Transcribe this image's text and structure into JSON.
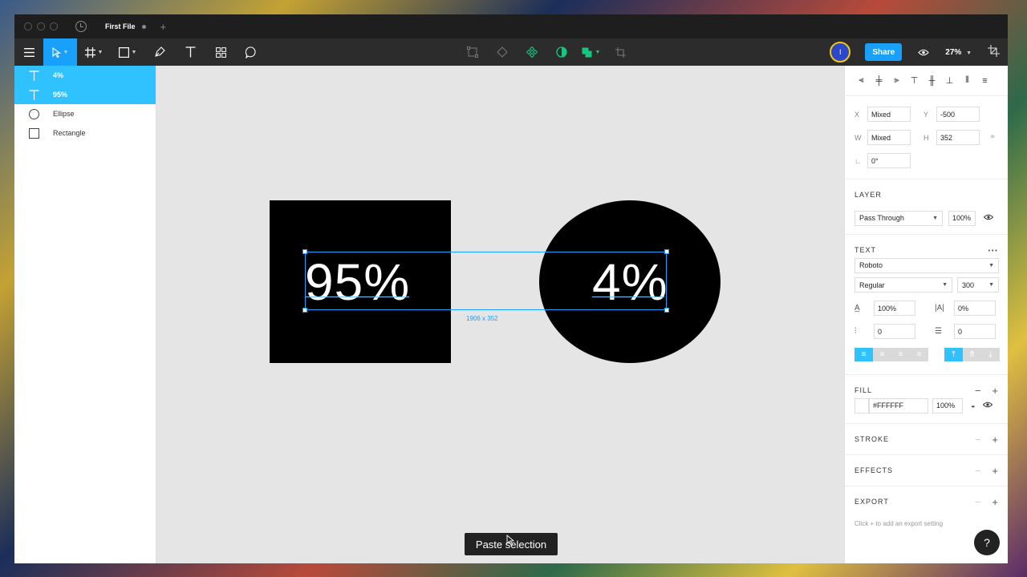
{
  "titlebar": {
    "file_name": "First File",
    "add_tab": "+"
  },
  "toolbar": {
    "avatar_initial": "I",
    "share_label": "Share",
    "zoom": "27%"
  },
  "layers": [
    {
      "name": "4%",
      "type": "text",
      "selected": true
    },
    {
      "name": "95%",
      "type": "text",
      "selected": true
    },
    {
      "name": "Ellipse",
      "type": "ellipse",
      "selected": false
    },
    {
      "name": "Rectangle",
      "type": "rectangle",
      "selected": false
    }
  ],
  "canvas": {
    "text_a": "95%",
    "text_b": "4%",
    "dimensions": "1906 x 352",
    "toast": "Paste selection"
  },
  "design": {
    "x_label": "X",
    "x_value": "Mixed",
    "y_label": "Y",
    "y_value": "-500",
    "w_label": "W",
    "w_value": "Mixed",
    "h_label": "H",
    "h_value": "352",
    "rotation": "0°",
    "layer_title": "LAYER",
    "blend_mode": "Pass Through",
    "layer_opacity": "100%",
    "text_title": "TEXT",
    "font_family": "Roboto",
    "font_style": "Regular",
    "font_size": "300",
    "line_height": "100%",
    "letter_spacing": "0%",
    "paragraph_spacing": "0",
    "paragraph_indent": "0",
    "fill_title": "FILL",
    "fill_hex": "#FFFFFF",
    "fill_opacity": "100%",
    "stroke_title": "STROKE",
    "effects_title": "EFFECTS",
    "export_title": "EXPORT",
    "export_hint": "Click + to add an export setting",
    "help": "?"
  },
  "colors": {
    "accent": "#18a0fb",
    "selection": "#30c2ff",
    "avatar_ring": "#f2c811"
  }
}
